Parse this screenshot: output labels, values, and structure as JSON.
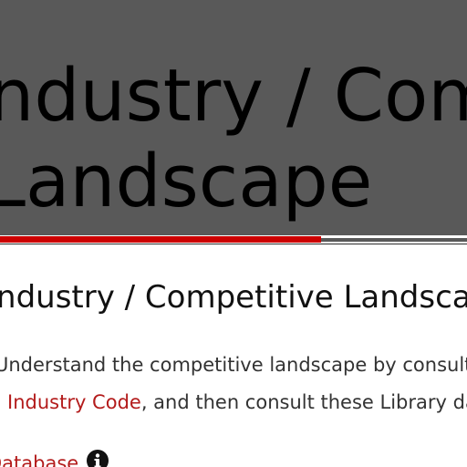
{
  "banner": {
    "title_line1": "Industry / Competitive",
    "title_line2": "Landscape"
  },
  "section": {
    "title": "Industry / Competitive Landscape"
  },
  "description": {
    "line1": "Understand the competitive landscape by consulting published",
    "line2_link": "Industry Code",
    "line2_text": ", and then consult these Library databases."
  },
  "database": {
    "link_label": "Database",
    "info_icon": "info-circle-icon"
  },
  "colors": {
    "banner_bg": "#595959",
    "accent_red": "#cc0000",
    "link": "#b31b1b"
  }
}
